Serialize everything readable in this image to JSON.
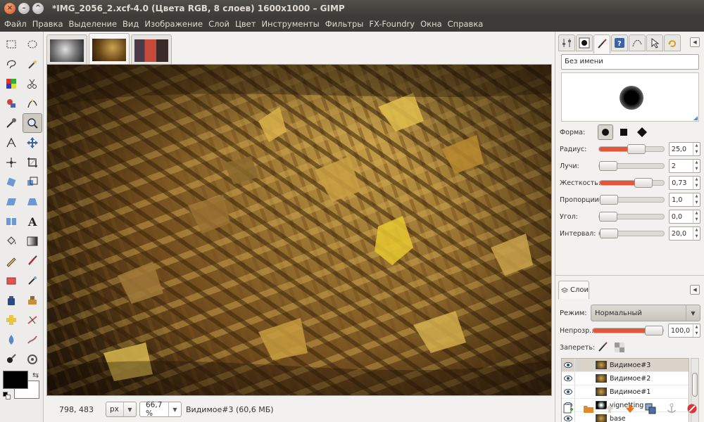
{
  "window": {
    "title": "*IMG_2056_2.xcf-4.0 (Цвета RGB, 8 слоев) 1600x1000 – GIMP"
  },
  "menu": [
    "Файл",
    "Правка",
    "Выделение",
    "Вид",
    "Изображение",
    "Слой",
    "Цвет",
    "Инструменты",
    "Фильтры",
    "FX-Foundry",
    "Окна",
    "Справка"
  ],
  "status": {
    "coords": "798, 483",
    "unit": "px",
    "zoom": "66,7 %",
    "message": "Видимое#3 (60,6 МБ)"
  },
  "brush_panel": {
    "brush_name": "Без имени",
    "shape_label": "Форма:",
    "props": [
      {
        "label": "Радиус:",
        "value": "25,0",
        "level": 0.55
      },
      {
        "label": "Лучи:",
        "value": "2",
        "level": 0.1
      },
      {
        "label": "Жесткость:",
        "value": "0,73",
        "level": 0.65
      },
      {
        "label": "Пропорции:",
        "value": "1,0",
        "level": 0.1
      },
      {
        "label": "Угол:",
        "value": "0,0",
        "level": 0.1
      },
      {
        "label": "Интервал:",
        "value": "20,0",
        "level": 0.15
      }
    ]
  },
  "layers_panel": {
    "tab_label": "Слои",
    "mode_label": "Режим:",
    "mode_value": "Нормальный",
    "opacity_label": "Непрозр.:",
    "opacity_value": "100,0",
    "opacity_level": 1.0,
    "lock_label": "Запереть:",
    "layers": [
      {
        "name": "Видимое#3",
        "selected": true
      },
      {
        "name": "Видимое#2",
        "selected": false
      },
      {
        "name": "Видимое#1",
        "selected": false
      },
      {
        "name": "vignetting",
        "selected": false
      },
      {
        "name": "base",
        "selected": false
      }
    ]
  },
  "colors": {
    "accent": "#e2573a",
    "titlebar": "#3c3b37",
    "foreground": "#000000",
    "background": "#ffffff"
  }
}
